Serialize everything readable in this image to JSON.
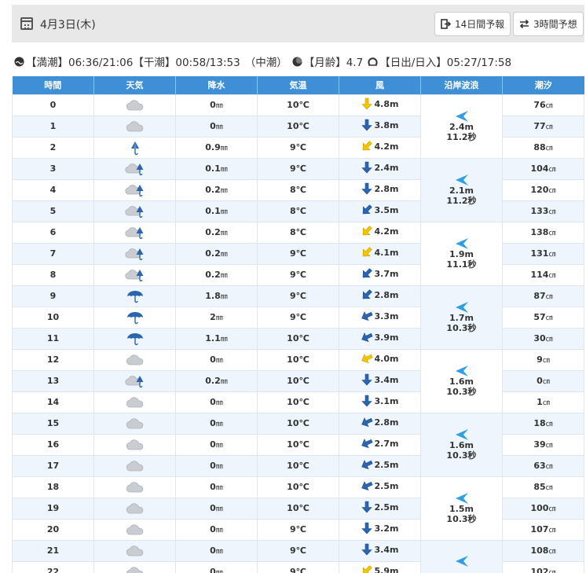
{
  "header": {
    "date": "4月3日(木)",
    "btn_14day": "14日間予報",
    "btn_3hour": "3時間予想"
  },
  "info": {
    "high_tide": "【満潮】06:36/21:06",
    "low_tide": "【干潮】00:58/13:53",
    "tide_type": "（中潮）",
    "moon_age": "【月齢】4.7",
    "sun": "【日出/日入】05:27/17:58"
  },
  "columns": [
    "時間",
    "天気",
    "降水",
    "気温",
    "風",
    "沿岸波浪",
    "潮汐"
  ],
  "colors": {
    "header_blue": "#3f8fd7",
    "row_alt": "#eef5fc",
    "wind_yellow": "#f5c400",
    "wind_blue": "#2b65b0",
    "wave_blue": "#2f9fe0"
  },
  "rows": [
    {
      "hour": "0",
      "weather": "cloudy",
      "rain": "0",
      "temp": "10℃",
      "wind_dir": "S",
      "wind_strong": true,
      "wind": "4.8m",
      "tide": "76"
    },
    {
      "hour": "1",
      "weather": "cloudy",
      "rain": "0",
      "temp": "10℃",
      "wind_dir": "S",
      "wind_strong": false,
      "wind": "3.8m",
      "tide": "77"
    },
    {
      "hour": "2",
      "weather": "rain",
      "rain": "0.9",
      "temp": "9℃",
      "wind_dir": "SW",
      "wind_strong": true,
      "wind": "4.2m",
      "tide": "88"
    },
    {
      "hour": "3",
      "weather": "cloudy-rain",
      "rain": "0.1",
      "temp": "9℃",
      "wind_dir": "S",
      "wind_strong": false,
      "wind": "2.4m",
      "tide": "104"
    },
    {
      "hour": "4",
      "weather": "cloudy-rain",
      "rain": "0.2",
      "temp": "8℃",
      "wind_dir": "S",
      "wind_strong": false,
      "wind": "2.8m",
      "tide": "120"
    },
    {
      "hour": "5",
      "weather": "cloudy-rain",
      "rain": "0.1",
      "temp": "8℃",
      "wind_dir": "SW",
      "wind_strong": false,
      "wind": "3.5m",
      "tide": "133"
    },
    {
      "hour": "6",
      "weather": "cloudy-rain",
      "rain": "0.2",
      "temp": "8℃",
      "wind_dir": "SW",
      "wind_strong": true,
      "wind": "4.2m",
      "tide": "138"
    },
    {
      "hour": "7",
      "weather": "cloudy-rain",
      "rain": "0.2",
      "temp": "9℃",
      "wind_dir": "SW",
      "wind_strong": true,
      "wind": "4.1m",
      "tide": "131"
    },
    {
      "hour": "8",
      "weather": "cloudy-rain",
      "rain": "0.2",
      "temp": "9℃",
      "wind_dir": "SW",
      "wind_strong": false,
      "wind": "3.7m",
      "tide": "114"
    },
    {
      "hour": "9",
      "weather": "umbrella",
      "rain": "1.8",
      "temp": "9℃",
      "wind_dir": "SW",
      "wind_strong": false,
      "wind": "2.8m",
      "tide": "87"
    },
    {
      "hour": "10",
      "weather": "umbrella",
      "rain": "2",
      "temp": "9℃",
      "wind_dir": "WSW",
      "wind_strong": false,
      "wind": "3.3m",
      "tide": "57"
    },
    {
      "hour": "11",
      "weather": "umbrella",
      "rain": "1.1",
      "temp": "10℃",
      "wind_dir": "WSW",
      "wind_strong": false,
      "wind": "3.9m",
      "tide": "30"
    },
    {
      "hour": "12",
      "weather": "cloudy",
      "rain": "0",
      "temp": "10℃",
      "wind_dir": "WSW",
      "wind_strong": true,
      "wind": "4.0m",
      "tide": "9"
    },
    {
      "hour": "13",
      "weather": "cloudy-rain",
      "rain": "0.2",
      "temp": "10℃",
      "wind_dir": "S",
      "wind_strong": false,
      "wind": "3.4m",
      "tide": "0"
    },
    {
      "hour": "14",
      "weather": "cloudy",
      "rain": "0",
      "temp": "10℃",
      "wind_dir": "S",
      "wind_strong": false,
      "wind": "3.1m",
      "tide": "1"
    },
    {
      "hour": "15",
      "weather": "cloudy",
      "rain": "0",
      "temp": "10℃",
      "wind_dir": "WSW",
      "wind_strong": false,
      "wind": "2.8m",
      "tide": "18"
    },
    {
      "hour": "16",
      "weather": "cloudy",
      "rain": "0",
      "temp": "10℃",
      "wind_dir": "WSW",
      "wind_strong": false,
      "wind": "2.7m",
      "tide": "39"
    },
    {
      "hour": "17",
      "weather": "cloudy",
      "rain": "0",
      "temp": "10℃",
      "wind_dir": "WSW",
      "wind_strong": false,
      "wind": "2.5m",
      "tide": "63"
    },
    {
      "hour": "18",
      "weather": "cloudy",
      "rain": "0",
      "temp": "10℃",
      "wind_dir": "WSW",
      "wind_strong": false,
      "wind": "2.5m",
      "tide": "85"
    },
    {
      "hour": "19",
      "weather": "cloudy",
      "rain": "0",
      "temp": "10℃",
      "wind_dir": "S",
      "wind_strong": false,
      "wind": "2.5m",
      "tide": "100"
    },
    {
      "hour": "20",
      "weather": "cloudy",
      "rain": "0",
      "temp": "9℃",
      "wind_dir": "S",
      "wind_strong": false,
      "wind": "3.2m",
      "tide": "107"
    },
    {
      "hour": "21",
      "weather": "cloudy",
      "rain": "0",
      "temp": "9℃",
      "wind_dir": "S",
      "wind_strong": false,
      "wind": "3.4m",
      "tide": "108"
    },
    {
      "hour": "22",
      "weather": "cloudy",
      "rain": "0",
      "temp": "9℃",
      "wind_dir": "SW",
      "wind_strong": true,
      "wind": "5.9m",
      "tide": "102"
    }
  ],
  "waves": [
    {
      "height": "2.4m",
      "period": "11.2秒"
    },
    {
      "height": "2.1m",
      "period": "11.2秒"
    },
    {
      "height": "1.9m",
      "period": "11.1秒"
    },
    {
      "height": "1.7m",
      "period": "10.3秒"
    },
    {
      "height": "1.6m",
      "period": "10.3秒"
    },
    {
      "height": "1.6m",
      "period": "10.3秒"
    },
    {
      "height": "1.5m",
      "period": "10.3秒"
    },
    {
      "height": "",
      "period": ""
    }
  ],
  "units": {
    "rain": "㎜",
    "tide": "㎝"
  }
}
